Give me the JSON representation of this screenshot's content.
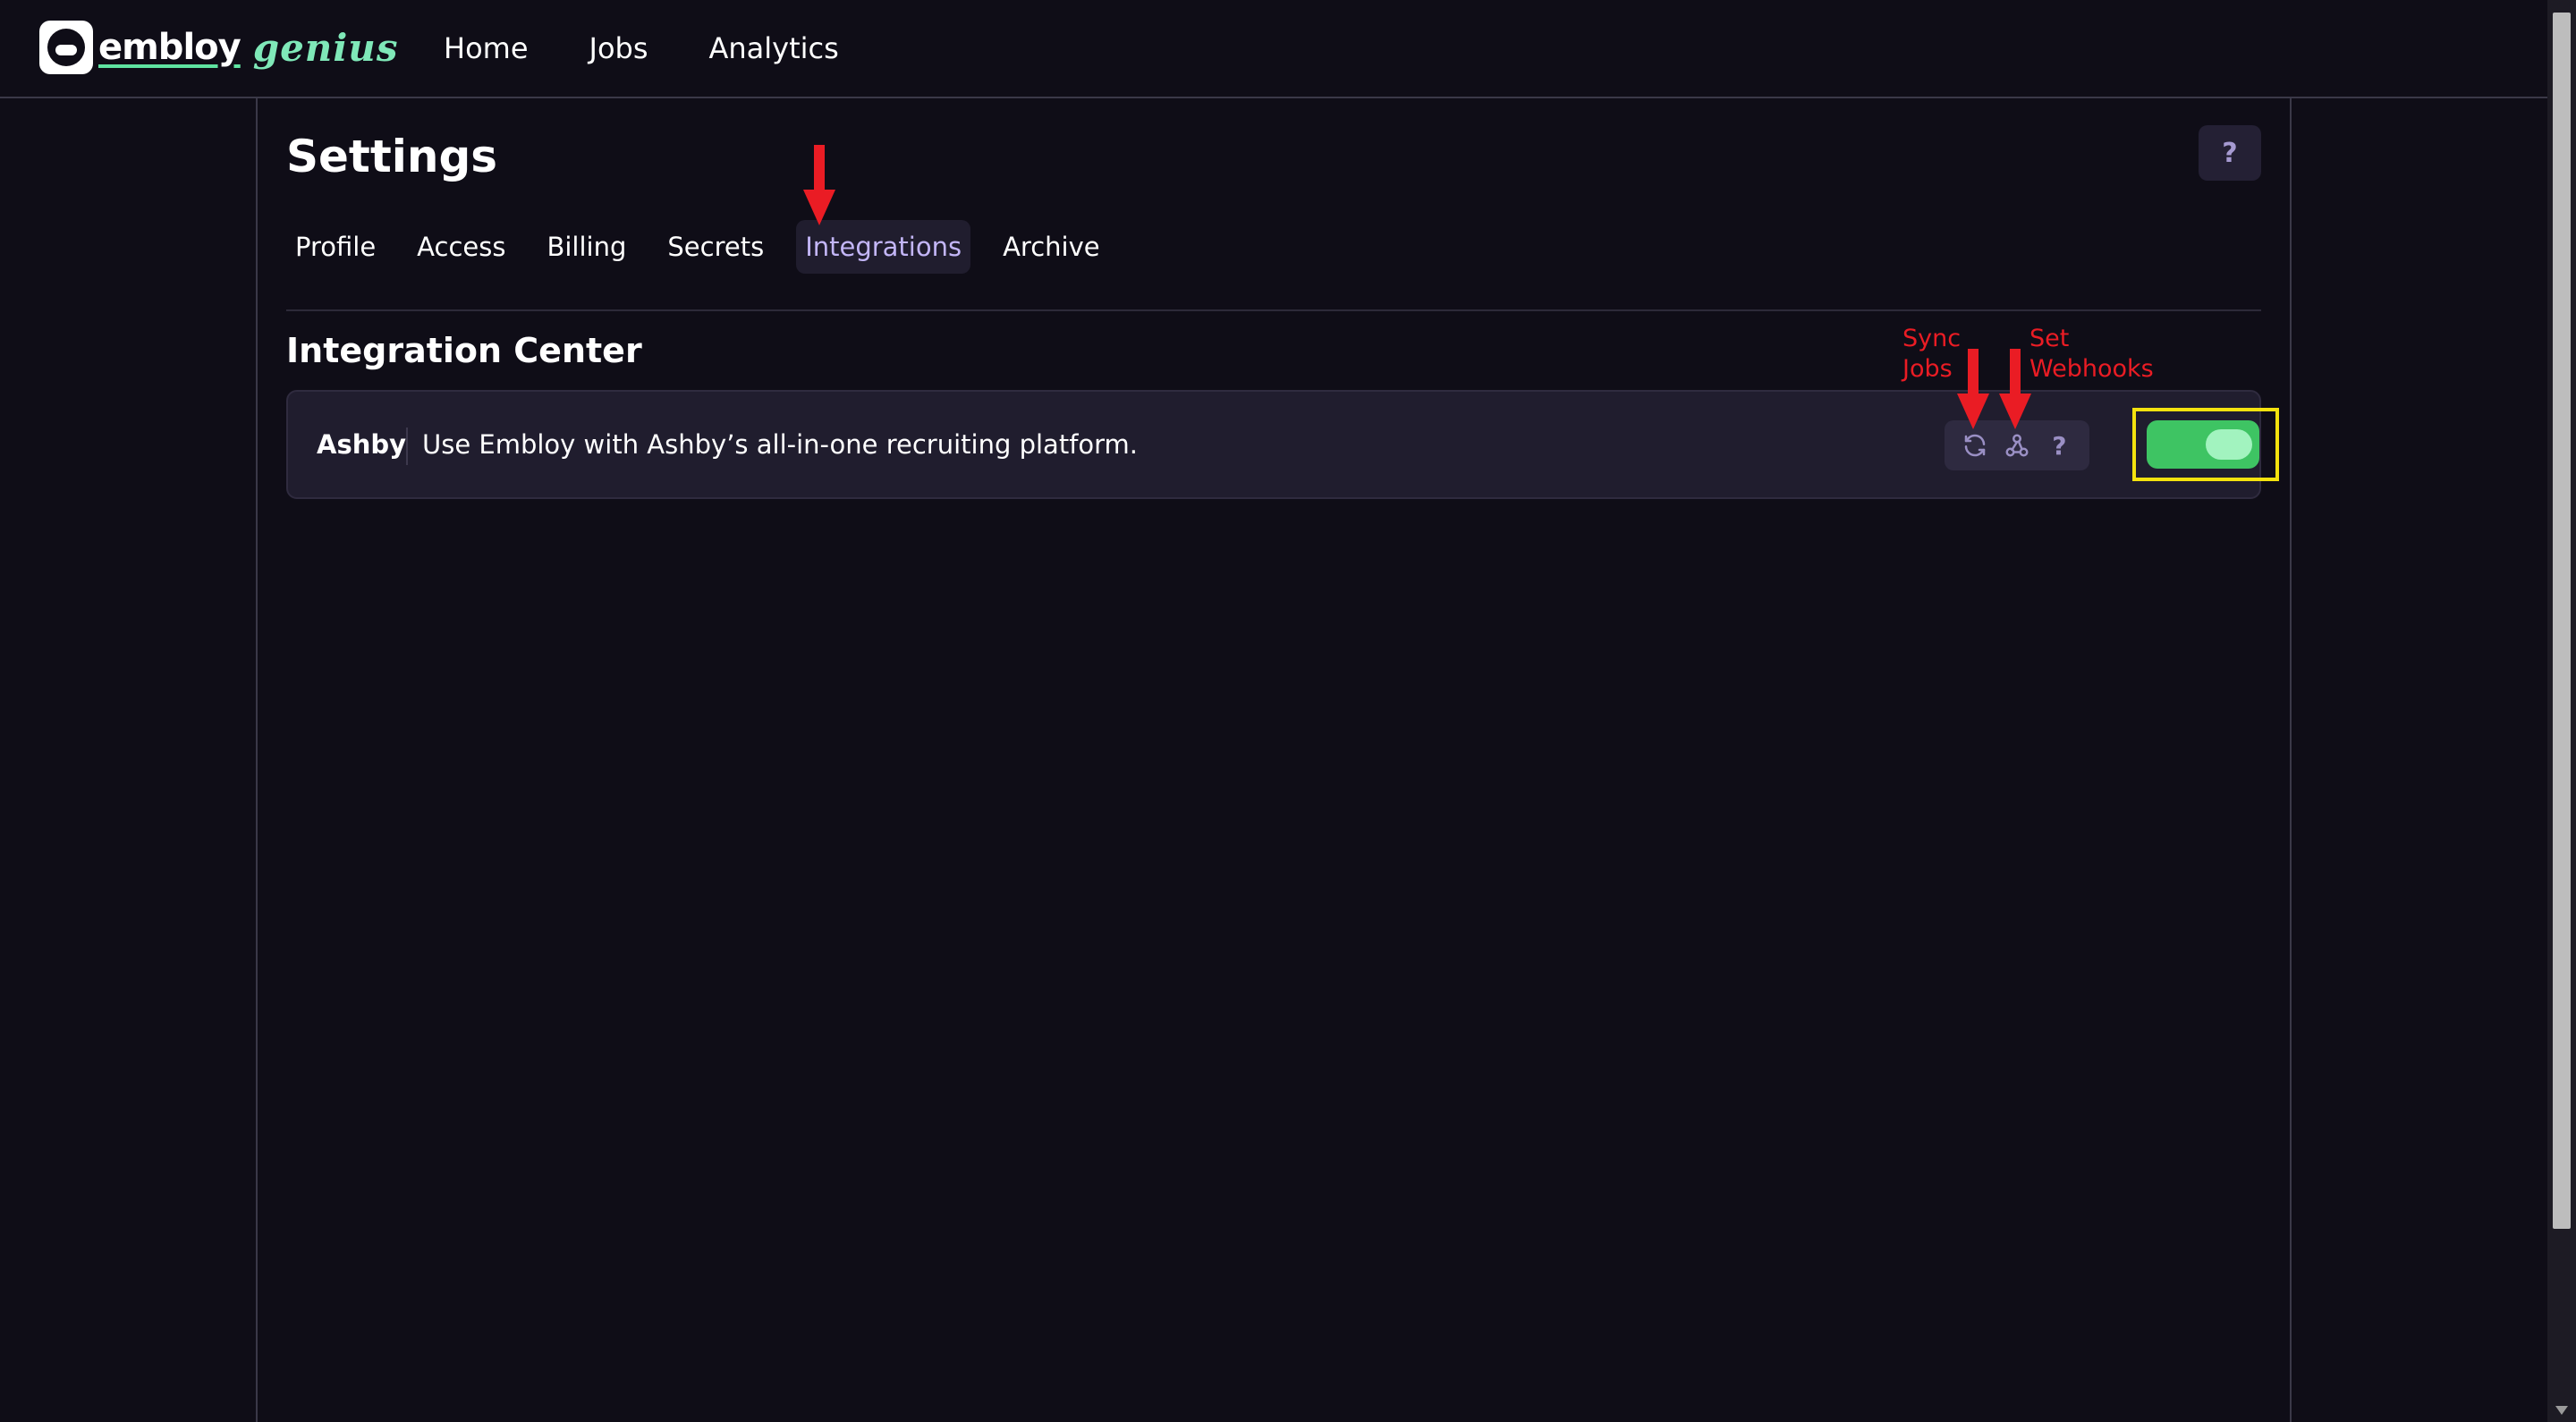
{
  "brand": {
    "name": "embloy",
    "suffix": "genius"
  },
  "nav": {
    "items": [
      {
        "label": "Home"
      },
      {
        "label": "Jobs"
      },
      {
        "label": "Analytics"
      }
    ]
  },
  "page": {
    "title": "Settings",
    "help_label": "?"
  },
  "tabs": [
    {
      "label": "Profile",
      "active": false
    },
    {
      "label": "Access",
      "active": false
    },
    {
      "label": "Billing",
      "active": false
    },
    {
      "label": "Secrets",
      "active": false
    },
    {
      "label": "Integrations",
      "active": true
    },
    {
      "label": "Archive",
      "active": false
    }
  ],
  "integration_center": {
    "title": "Integration Center",
    "card": {
      "name": "Ashby",
      "description": "Use Embloy with Ashby’s all-in-one recruiting platform.",
      "help_label": "?",
      "enabled": true
    }
  },
  "annotations": {
    "sync": {
      "line1": "Sync",
      "line2": "Jobs"
    },
    "webhooks": {
      "line1": "Set",
      "line2": "Webhooks"
    }
  },
  "icons": [
    "logo-icon",
    "sync-icon",
    "webhook-icon",
    "help-icon"
  ],
  "colors": {
    "background": "#0f0d17",
    "accent": "#c3b6f7",
    "toggle_on": "#3ec463",
    "annotation_red": "#ea1c24",
    "highlight_yellow": "#f4e20e"
  }
}
